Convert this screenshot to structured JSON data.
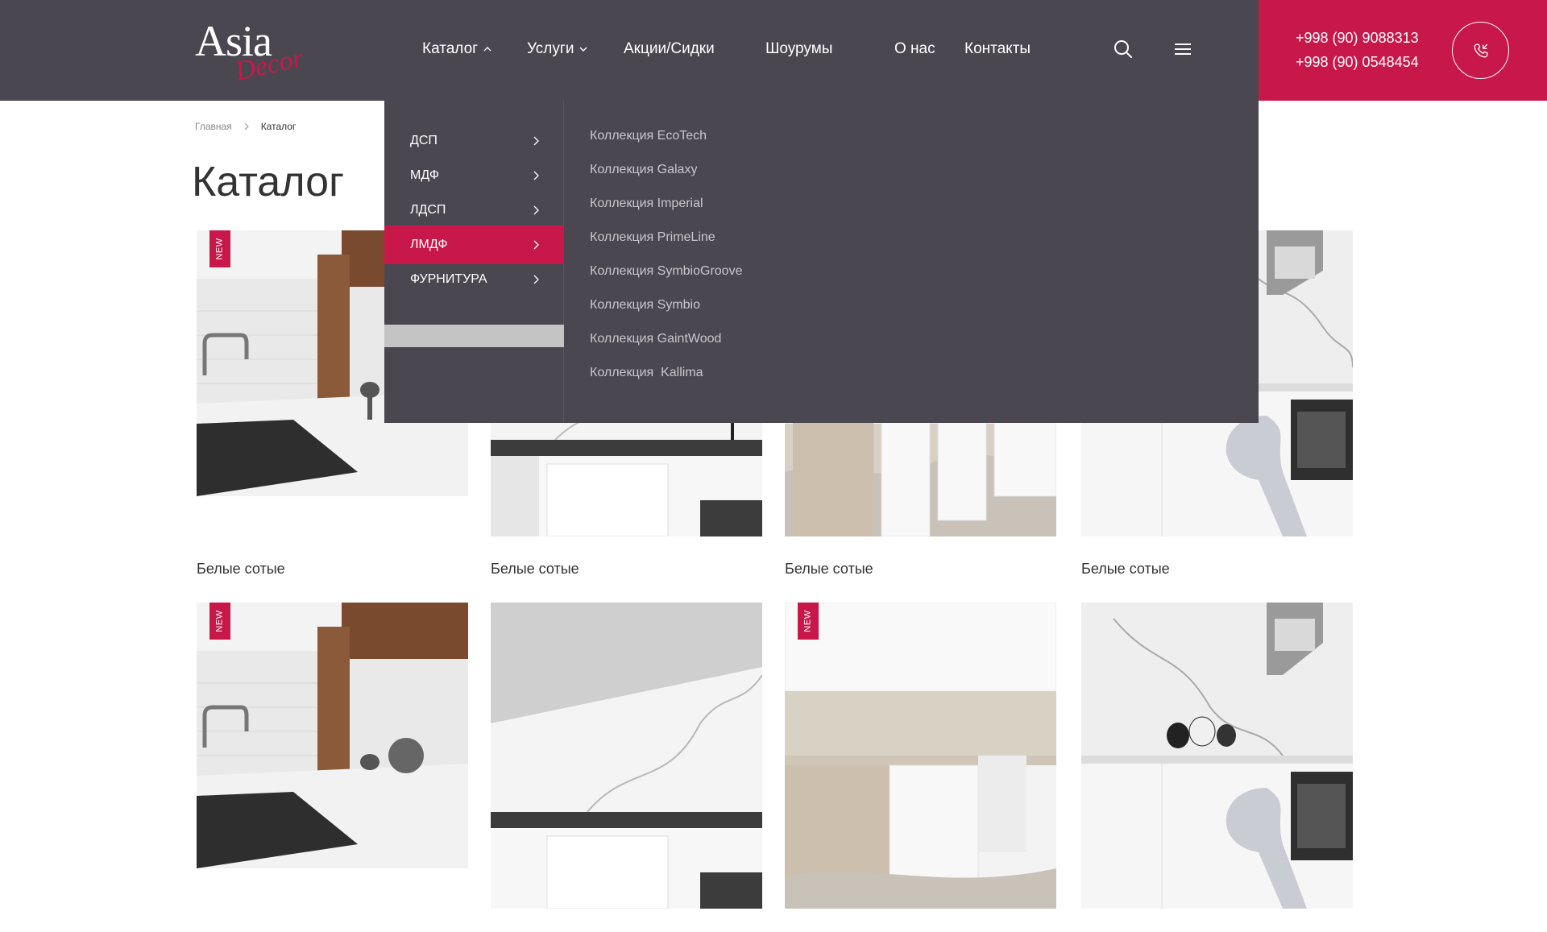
{
  "logo": {
    "main": "Asia",
    "sub": "Decor"
  },
  "nav": {
    "catalog": "Каталог",
    "services": "Услуги",
    "promotions": "Акции/Сидки",
    "showrooms": "Шоурумы",
    "about": "О нас",
    "contacts": "Контакты"
  },
  "phones": [
    "+998 (90) 9088313",
    "+998 (90) 0548454"
  ],
  "breadcrumb": {
    "home": "Главная",
    "current": "Каталог"
  },
  "page_title": "Каталог",
  "dropdown": {
    "categories": [
      {
        "label": "ДСП",
        "active": false
      },
      {
        "label": "МДФ",
        "active": false
      },
      {
        "label": "ЛДСП",
        "active": false
      },
      {
        "label": "ЛМДФ",
        "active": true
      },
      {
        "label": "ФУРНИТУРА",
        "active": false
      }
    ],
    "collections": [
      "Коллекция EcoTech",
      "Коллекция Galaxy",
      "Коллекция Imperial",
      "Коллекция PrimeLine",
      "Коллекция SymbioGroove",
      "Коллекция Symbio",
      "Коллекция GaintWood",
      "Коллекция  Kallima"
    ]
  },
  "badge_new": "NEW",
  "products": [
    {
      "title": "Белые сотые",
      "image": "kitchen-black-sink",
      "new": true
    },
    {
      "title": "Белые сотые",
      "image": "kitchen-marble-wall",
      "new": false
    },
    {
      "title": "Белые сотые",
      "image": "kitchen-white-cabinets",
      "new": false
    },
    {
      "title": "Белые сотые",
      "image": "kitchen-marble-chair",
      "new": false
    },
    {
      "title": "",
      "image": "kitchen-black-sink",
      "new": true
    },
    {
      "title": "",
      "image": "kitchen-marble-wall",
      "new": false
    },
    {
      "title": "",
      "image": "kitchen-white-cabinets",
      "new": true
    },
    {
      "title": "",
      "image": "kitchen-marble-chair",
      "new": false
    }
  ],
  "colors": {
    "header": "#4a4750",
    "accent": "#c8184a"
  }
}
